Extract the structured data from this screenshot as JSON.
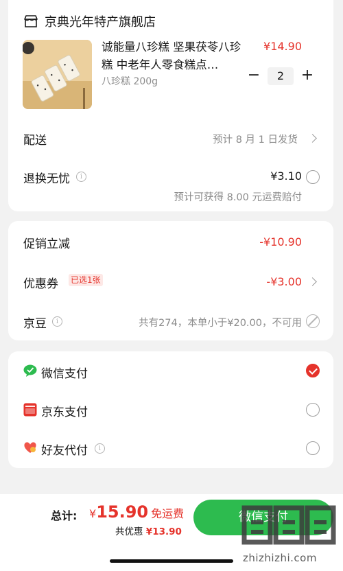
{
  "shop": {
    "name": "京典光年特产旗舰店",
    "product": {
      "title": "诚能量八珍糕 坚果茯苓八珍糕 中老年人零食糕点…",
      "spec": "八珍糕 200g",
      "price": "¥14.90",
      "quantity": "2",
      "minus": "−",
      "plus": "+"
    },
    "delivery": {
      "label": "配送",
      "value": "预计 8 月 1 日发货"
    },
    "return_insurance": {
      "label": "退换无忧",
      "price": "¥3.10",
      "note": "预计可获得 8.00 元运费赔付",
      "checked": false
    }
  },
  "promo": {
    "discount": {
      "label": "促销立减",
      "value": "-¥10.90"
    },
    "coupon": {
      "label": "优惠券",
      "badge": "已选1张",
      "value": "-¥3.00"
    },
    "jingdou": {
      "label": "京豆",
      "value": "共有274，本单小于¥20.00，不可用"
    }
  },
  "payment": {
    "methods": [
      {
        "label": "微信支付",
        "icon": "wechat-pay-icon",
        "selected": true
      },
      {
        "label": "京东支付",
        "icon": "jd-pay-icon",
        "selected": false
      },
      {
        "label": "好友代付",
        "icon": "friend-pay-icon",
        "selected": false
      }
    ]
  },
  "footer": {
    "total_label": "总计:",
    "currency": "¥",
    "total": "15.90",
    "shipping": "免运费",
    "saved_label": "共优惠",
    "saved_value": "¥13.90",
    "pay_button": "微信支付",
    "watermark": "zhizhizhi.com"
  },
  "colors": {
    "accent_red": "#e5332b",
    "wechat_green": "#2dbb4f"
  }
}
